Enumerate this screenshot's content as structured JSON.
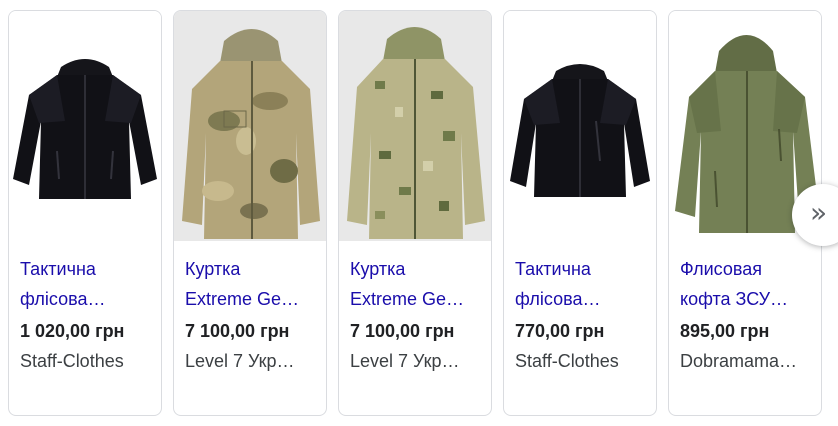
{
  "products": [
    {
      "title_line1": "Тактична",
      "title_line2": "флісова…",
      "price": "1 020,00 грн",
      "merchant": "Staff-Clothes",
      "image_icon": "black-fleece-jacket-image"
    },
    {
      "title_line1": "Куртка",
      "title_line2": "Extreme Ge…",
      "price": "7 100,00 грн",
      "merchant": "Level 7 Укр…",
      "image_icon": "multicam-camo-jacket-image"
    },
    {
      "title_line1": "Куртка",
      "title_line2": "Extreme Ge…",
      "price": "7 100,00 грн",
      "merchant": "Level 7 Укр…",
      "image_icon": "pixel-camo-jacket-image"
    },
    {
      "title_line1": "Тактична",
      "title_line2": "флісова…",
      "price": "770,00 грн",
      "merchant": "Staff-Clothes",
      "image_icon": "black-fleece-jacket-image"
    },
    {
      "title_line1": "Флисовая",
      "title_line2": "кофта ЗСУ…",
      "price": "895,00 грн",
      "merchant": "Dobramama…",
      "image_icon": "olive-fleece-hoodie-image"
    }
  ],
  "next_button": {
    "glyph": "»"
  },
  "colors": {
    "link": "#1a0dab",
    "price": "#202124",
    "merchant": "#3c4043",
    "card_border": "#dadce0"
  }
}
